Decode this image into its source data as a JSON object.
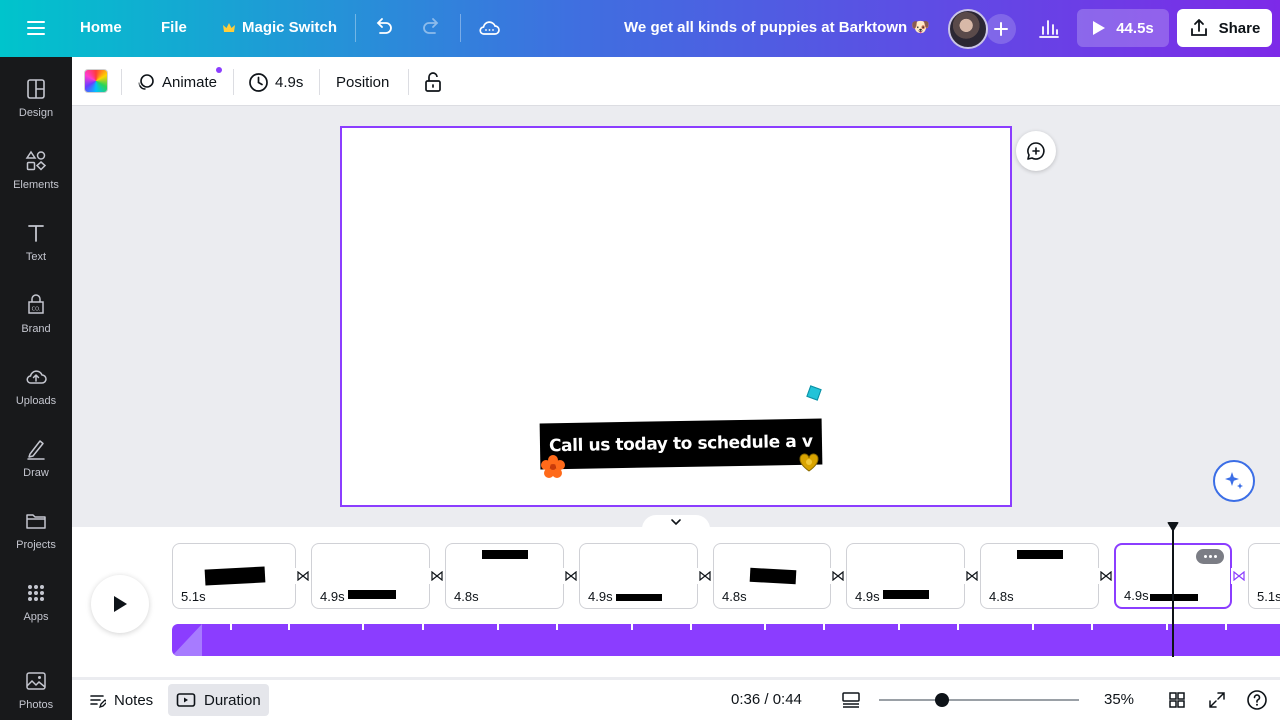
{
  "topbar": {
    "home": "Home",
    "file": "File",
    "magic_switch": "Magic Switch",
    "title": "We get all kinds of puppies at Barktown 🐶",
    "present_duration": "44.5s",
    "share": "Share"
  },
  "sidebar": {
    "items": [
      {
        "label": "Design",
        "icon": "layout-icon"
      },
      {
        "label": "Elements",
        "icon": "shapes-icon"
      },
      {
        "label": "Text",
        "icon": "text-icon"
      },
      {
        "label": "Brand",
        "icon": "brand-icon"
      },
      {
        "label": "Uploads",
        "icon": "cloud-upload-icon"
      },
      {
        "label": "Draw",
        "icon": "pen-icon"
      },
      {
        "label": "Projects",
        "icon": "folder-icon"
      },
      {
        "label": "Apps",
        "icon": "grid-icon"
      },
      {
        "label": "Photos",
        "icon": "image-icon"
      }
    ]
  },
  "context_toolbar": {
    "animate": "Animate",
    "duration": "4.9s",
    "position": "Position"
  },
  "canvas": {
    "banner_text": "Call us today to schedule a v"
  },
  "timeline": {
    "pages": [
      {
        "duration": "5.1s"
      },
      {
        "duration": "4.9s"
      },
      {
        "duration": "4.8s"
      },
      {
        "duration": "4.9s"
      },
      {
        "duration": "4.8s"
      },
      {
        "duration": "4.9s"
      },
      {
        "duration": "4.8s"
      },
      {
        "duration": "4.9s",
        "active": true
      },
      {
        "duration": "5.1s"
      }
    ]
  },
  "footer": {
    "notes": "Notes",
    "duration": "Duration",
    "time": "0:36 / 0:44",
    "zoom": "35%",
    "zoom_level": 0.35
  },
  "colors": {
    "accent": "#8b3dff",
    "sidebar_bg": "#18191b",
    "gradient_start": "#00c4cc",
    "gradient_end": "#7d2ae8"
  }
}
